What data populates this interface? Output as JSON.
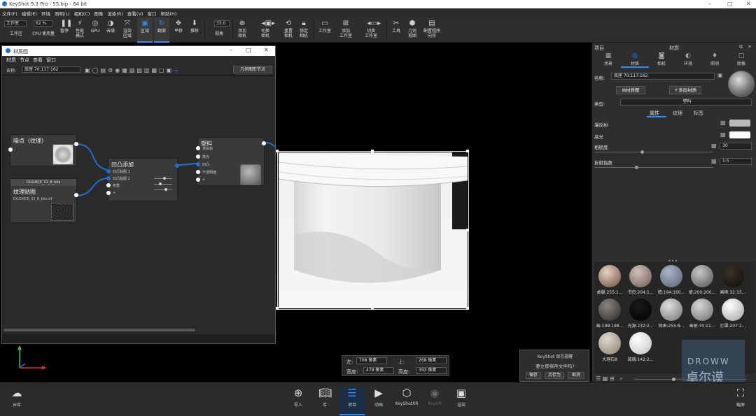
{
  "app": {
    "title": "KeyShot 9.3 Pro - 55.bip - 64 bit",
    "win_min": "–",
    "win_max": "□",
    "win_close": "✕"
  },
  "menu": [
    "文件(F)",
    "编辑(E)",
    "环境",
    "照明(L)",
    "相机(C)",
    "图像",
    "渲染(R)",
    "查看(V)",
    "窗口",
    "帮助(H)"
  ],
  "toolbar": {
    "workspace_select": "工作室",
    "workspace_label": "工作区",
    "cpu_value": "62 %",
    "cpu_label": "CPU 使用量",
    "pause": "暂停",
    "perf_mode": "性能\n模式",
    "gpu": "GPU",
    "denoise": "去噪",
    "render_region": "渲染\n区域",
    "region": "区域",
    "flip": "翻滚",
    "pan": "平移",
    "dolly": "推移",
    "fov_value": "33.0",
    "fov_label": "视角",
    "add_camera": "添加\n相机",
    "switch_camera": "切换\n相机",
    "reset_camera": "重置\n相机",
    "lock_camera": "锁定\n相机",
    "studio": "工作室",
    "add_studio": "添加\n工作室",
    "switch_studio": "切换\n工作室",
    "tools": "工具",
    "geometry_view": "几何\n视图",
    "configurator_view": "配置程序\n向导"
  },
  "material_graph": {
    "title": "材质图",
    "menu": [
      "材质",
      "节点",
      "查看",
      "窗口"
    ],
    "name_label": "名称:",
    "name_value": "底座 70:117:162",
    "geo_node_btn": "几何图形节点",
    "nodes": {
      "noise": {
        "title": "噪点（纹理）"
      },
      "texture": {
        "header": "DGGMCE_02_8_bits",
        "title": "纹理贴图",
        "file": "DGGMCE_02_8_bits.tif"
      },
      "bump": {
        "title": "凹凸添加",
        "ports": [
          "凹凸贴图 1",
          "凹凸贴图 2",
          "权重",
          "+"
        ]
      },
      "plastic": {
        "title": "塑料",
        "ports": [
          "漫反射",
          "高光",
          "凹凸",
          "不透明度",
          "+"
        ]
      }
    }
  },
  "right_panel": {
    "header_left": "项目",
    "header_center": "材质",
    "tabs": [
      {
        "label": "场景",
        "icon": "scene-icon"
      },
      {
        "label": "材质",
        "icon": "material-icon"
      },
      {
        "label": "相机",
        "icon": "camera-icon"
      },
      {
        "label": "环境",
        "icon": "environment-icon"
      },
      {
        "label": "照明",
        "icon": "lighting-icon"
      },
      {
        "label": "图像",
        "icon": "image-icon"
      }
    ],
    "name_label": "名称:",
    "name_value": "底座 70:117:162",
    "material_graph_btn": "材质图",
    "multi_layer_btn": "多层材质",
    "type_label": "类型:",
    "type_value": "塑料",
    "subtabs": [
      "属性",
      "纹理",
      "标签"
    ],
    "props": [
      {
        "label": "漫反射",
        "color": "#b8b8b8"
      },
      {
        "label": "高光",
        "color": "#ffffff"
      },
      {
        "label": "粗糙度",
        "value": "30",
        "fill": 0.4
      },
      {
        "label": "折射指数",
        "value": "1.5",
        "fill": 0.35
      }
    ],
    "library": [
      {
        "label": "桌腿:255:1...",
        "c1": "#e8d2c0",
        "c2": "#6b4a3a"
      },
      {
        "label": "书页:204:1...",
        "c1": "#d0c0b8",
        "c2": "#6a5a55"
      },
      {
        "label": "墙:194:160...",
        "c1": "#a8b4c8",
        "c2": "#5a6070"
      },
      {
        "label": "墙:200:200...",
        "c1": "#c8c8c8",
        "c2": "#505050"
      },
      {
        "label": "画框:32:15...",
        "c1": "#3a3228",
        "c2": "#0e0c0a"
      },
      {
        "label": "画:198:198...",
        "c1": "#8a8680",
        "c2": "#2a2826"
      },
      {
        "label": "光源:232:2...",
        "c1": "#1a1a1a",
        "c2": "#000000"
      },
      {
        "label": "钟表:255:8...",
        "c1": "#e0e0e0",
        "c2": "#707070"
      },
      {
        "label": "画册:70:11...",
        "c1": "#d8d8d8",
        "c2": "#6a6a6a"
      },
      {
        "label": "灯罩:207:2...",
        "c1": "#ffffff",
        "c2": "#a0a0a0"
      },
      {
        "label": "大理石8",
        "c1": "#e0d8cc",
        "c2": "#8a8070"
      },
      {
        "label": "玻璃:142:2...",
        "c1": "#ffffff",
        "c2": "#c0c0c0"
      }
    ]
  },
  "region_box": {
    "left_label": "左:",
    "left_value": "708 像素",
    "top_label": "上:",
    "top_value": "268 像素",
    "width_label": "宽度:",
    "width_value": "478 像素",
    "height_label": "高度:",
    "height_value": "393 像素"
  },
  "save_dialog": {
    "title": "KeyShot 保存提醒",
    "message": "要立即保存文件吗?",
    "save": "保存",
    "save_as": "另存为",
    "cancel": "取消"
  },
  "bottom": {
    "cloud": "云库",
    "items": [
      "导入",
      "库",
      "项目",
      "动画",
      "KeyShotXR",
      "KeyVR",
      "渲染"
    ],
    "screenshot": "截屏"
  },
  "watermark": {
    "en": "DROWW",
    "cn": "卓尔谟"
  }
}
